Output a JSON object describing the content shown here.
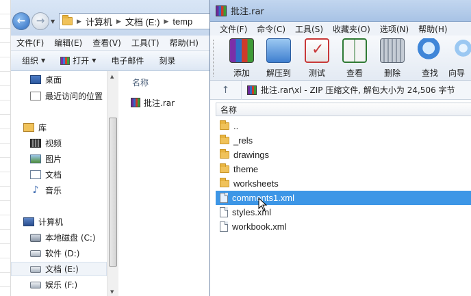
{
  "explorer": {
    "address_path": [
      "计算机",
      "文档 (E:)",
      "temp"
    ],
    "menu": [
      "文件(F)",
      "编辑(E)",
      "查看(V)",
      "工具(T)",
      "帮助(H)"
    ],
    "toolbar": {
      "organize": "组织",
      "open": "打开",
      "email": "电子邮件",
      "burn": "刻录"
    },
    "nav": {
      "desktop": "桌面",
      "recent": "最近访问的位置",
      "library": "库",
      "video": "视频",
      "pictures": "图片",
      "documents": "文档",
      "music": "音乐",
      "computer": "计算机",
      "drive_c": "本地磁盘 (C:)",
      "drive_d": "软件 (D:)",
      "drive_e": "文档 (E:)",
      "drive_f": "娱乐 (F:)"
    },
    "column_name": "名称",
    "file": "批注.rar"
  },
  "winrar": {
    "title": "批注.rar",
    "menu": [
      "文件(F)",
      "命令(C)",
      "工具(S)",
      "收藏夹(O)",
      "选项(N)",
      "帮助(H)"
    ],
    "tools": {
      "add": "添加",
      "extract": "解压到",
      "test": "测试",
      "view": "查看",
      "delete": "删除",
      "find": "查找",
      "wizard": "向导"
    },
    "path_text": "批注.rar\\xl - ZIP 压缩文件, 解包大小为 24,506 字节",
    "column_name": "名称",
    "entries": [
      {
        "name": "..",
        "type": "folder"
      },
      {
        "name": "_rels",
        "type": "folder"
      },
      {
        "name": "drawings",
        "type": "folder"
      },
      {
        "name": "theme",
        "type": "folder"
      },
      {
        "name": "worksheets",
        "type": "folder"
      },
      {
        "name": "comments1.xml",
        "type": "file",
        "selected": true
      },
      {
        "name": "styles.xml",
        "type": "file"
      },
      {
        "name": "workbook.xml",
        "type": "file"
      }
    ]
  },
  "colors": {
    "selection": "#3d96e6",
    "titlebar": "#b5cde9"
  }
}
